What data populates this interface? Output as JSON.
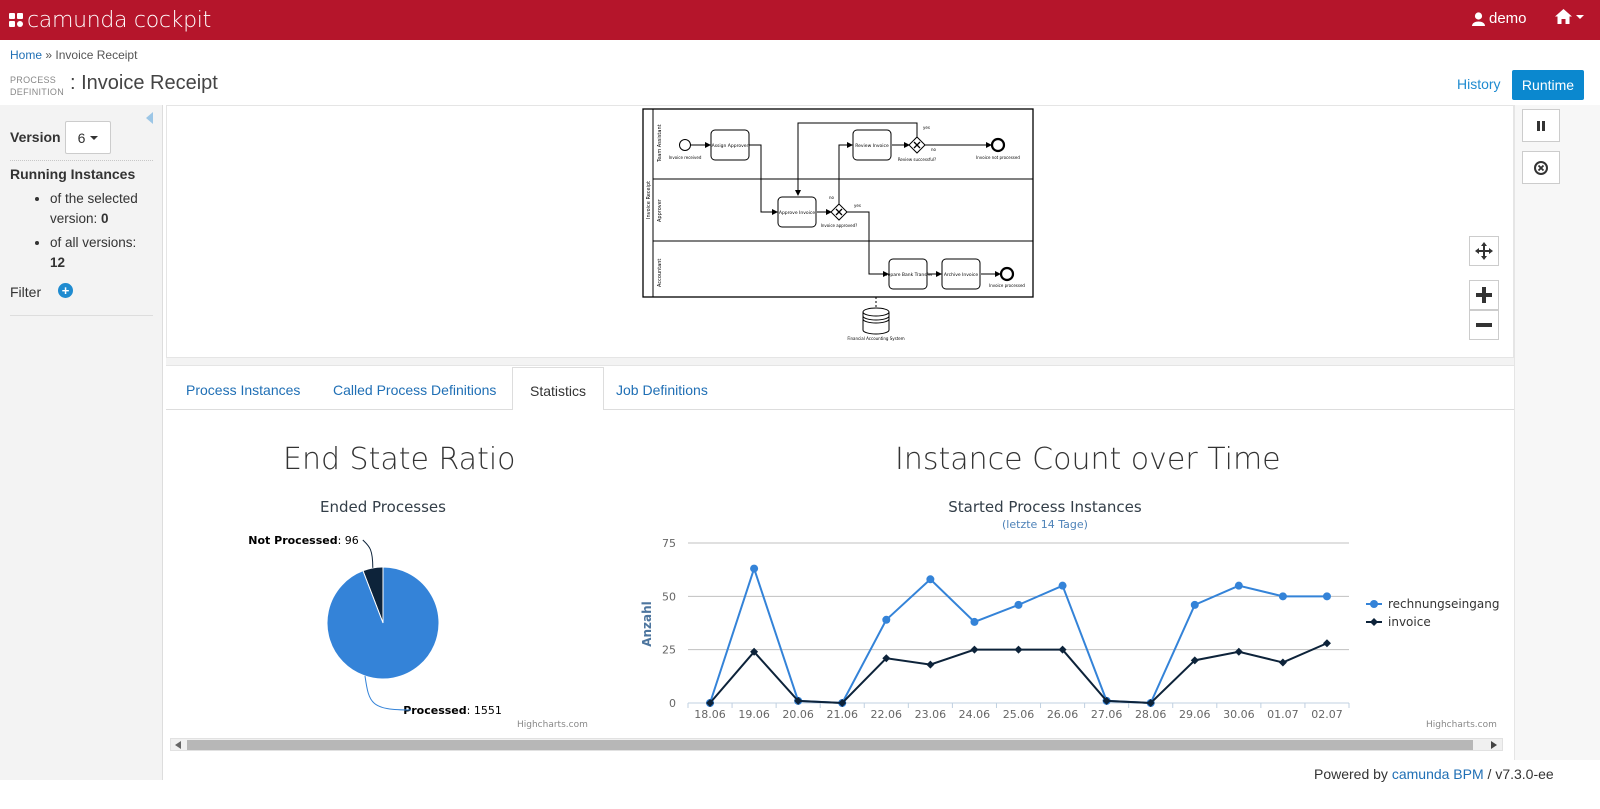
{
  "app": {
    "brand": "camunda cockpit",
    "user": "demo",
    "colors": {
      "header": "#b5152b",
      "accent": "#0b88cf",
      "series1": "#3483d8",
      "series2": "#0d233a"
    }
  },
  "breadcrumb": {
    "home": "Home",
    "separator": "»",
    "current": "Invoice Receipt"
  },
  "header": {
    "label_line1": "PROCESS",
    "label_line2": "DEFINITION",
    "title": ": Invoice Receipt",
    "history_label": "History",
    "runtime_label": "Runtime"
  },
  "sidebar": {
    "version_label": "Version",
    "version_value": "6",
    "running_title": "Running Instances",
    "selected_text": "of the selected version:",
    "selected_count": "0",
    "all_text": "of all versions:",
    "all_count": "12",
    "filter_label": "Filter"
  },
  "diagram": {
    "lanes": [
      "Team Assistant",
      "Approver",
      "Accountant"
    ],
    "pool": "Invoice Receipt",
    "tasks": [
      "Assign Approver",
      "Review Invoice",
      "Approve Invoice",
      "Prepare Bank Transfer",
      "Archive Invoice"
    ],
    "events": [
      "Invoice received",
      "Invoice not processed",
      "Invoice processed"
    ],
    "gateways": [
      "Review successful?",
      "Invoice approved?"
    ],
    "flow_labels": [
      "yes",
      "no",
      "no",
      "yes"
    ],
    "datastore": "Financial Accounting System"
  },
  "tabs": [
    {
      "label": "Process Instances"
    },
    {
      "label": "Called Process Definitions"
    },
    {
      "label": "Statistics"
    },
    {
      "label": "Job Definitions"
    }
  ],
  "stats": {
    "pie_heading": "End State Ratio",
    "line_heading": "Instance Count over Time",
    "credit": "Highcharts.com"
  },
  "chart_data": [
    {
      "type": "pie",
      "title": "Ended Processes",
      "slices": [
        {
          "name": "Processed",
          "value": 1551,
          "color": "#3483d8"
        },
        {
          "name": "Not Processed",
          "value": 96,
          "color": "#0d233a"
        }
      ]
    },
    {
      "type": "line",
      "title": "Started Process Instances",
      "subtitle": "(letzte 14 Tage)",
      "ylabel": "Anzahl",
      "xlabel": "",
      "ylim": [
        0,
        75
      ],
      "yticks": [
        0,
        25,
        50,
        75
      ],
      "grid": true,
      "legend": "right",
      "categories": [
        "18.06",
        "19.06",
        "20.06",
        "21.06",
        "22.06",
        "23.06",
        "24.06",
        "25.06",
        "26.06",
        "27.06",
        "28.06",
        "29.06",
        "30.06",
        "01.07",
        "02.07"
      ],
      "series": [
        {
          "name": "rechnungseingang",
          "color": "#3483d8",
          "marker": "circle",
          "values": [
            0,
            63,
            1,
            0,
            39,
            58,
            38,
            46,
            55,
            1,
            0,
            46,
            55,
            50,
            50
          ]
        },
        {
          "name": "invoice",
          "color": "#0d233a",
          "marker": "diamond",
          "values": [
            0,
            24,
            1,
            0,
            21,
            18,
            25,
            25,
            25,
            1,
            0,
            20,
            24,
            19,
            28
          ]
        }
      ]
    }
  ],
  "footer": {
    "prefix": "Powered by",
    "link": "camunda BPM",
    "version": "/ v7.3.0-ee"
  }
}
